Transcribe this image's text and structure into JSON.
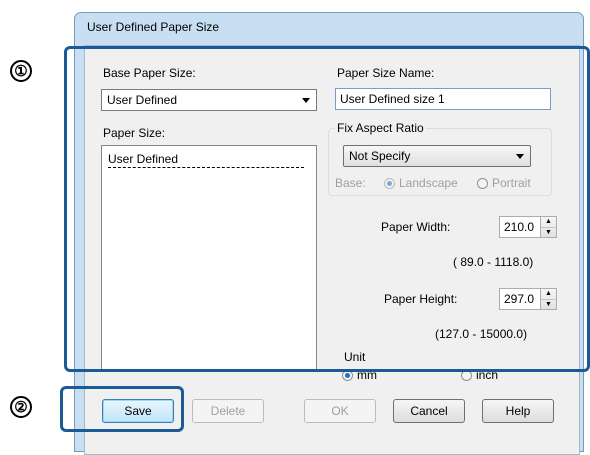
{
  "callouts": {
    "one": "①",
    "two": "②"
  },
  "dialog": {
    "title": "User Defined Paper Size",
    "base_paper_size": {
      "label": "Base Paper Size:",
      "value": "User Defined"
    },
    "paper_size_name": {
      "label": "Paper Size Name:",
      "value": "User Defined size 1"
    },
    "paper_size": {
      "label": "Paper Size:",
      "items": [
        "User Defined"
      ]
    },
    "fix_aspect_ratio": {
      "label": "Fix Aspect Ratio",
      "value": "Not Specify",
      "base_label": "Base:",
      "options": [
        {
          "label": "Landscape",
          "selected": true
        },
        {
          "label": "Portrait",
          "selected": false
        }
      ]
    },
    "paper_width": {
      "label": "Paper Width:",
      "value": "210.0",
      "range": "( 89.0 - 1118.0)"
    },
    "paper_height": {
      "label": "Paper Height:",
      "value": "297.0",
      "range": "(127.0 - 15000.0)"
    },
    "unit": {
      "label": "Unit",
      "options": [
        {
          "label": "mm",
          "selected": true
        },
        {
          "label": "inch",
          "selected": false
        }
      ]
    },
    "buttons": {
      "save": "Save",
      "delete": "Delete",
      "ok": "OK",
      "cancel": "Cancel",
      "help": "Help"
    }
  },
  "colors": {
    "highlight": "#1b5a95",
    "titlebar": "#c8dff3",
    "radio_selected": "#1f6fcf"
  }
}
